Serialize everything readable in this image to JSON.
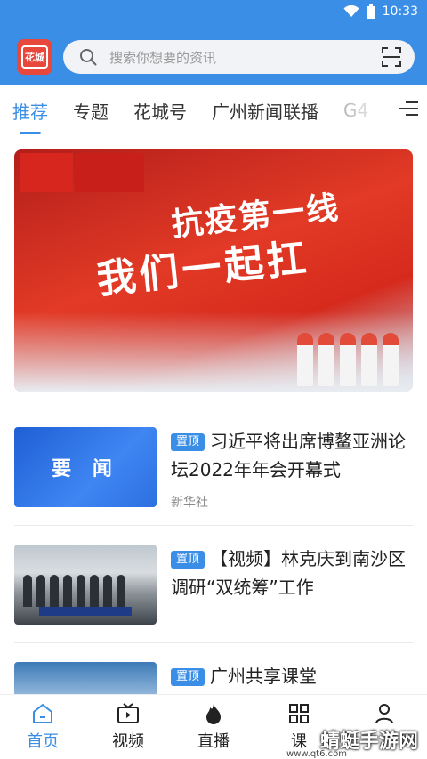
{
  "status_bar": {
    "time": "10:33"
  },
  "header": {
    "logo_text": "花城",
    "search_placeholder": "搜索你想要的资讯"
  },
  "tabs": [
    {
      "label": "推荐",
      "active": true
    },
    {
      "label": "专题"
    },
    {
      "label": "花城号"
    },
    {
      "label": "广州新闻联播"
    },
    {
      "label": "G4"
    }
  ],
  "banner": {
    "line1": "抗疫第一线",
    "line2": "我们一起扛"
  },
  "news": [
    {
      "pin": "置顶",
      "title": "习近平将出席博鳌亚洲论坛2022年年会开幕式",
      "source": "新华社",
      "thumb_text": "要 闻"
    },
    {
      "pin": "置顶",
      "title": "【视频】林克庆到南沙区调研“双统筹”工作",
      "source": ""
    },
    {
      "pin": "置顶",
      "title": "广州共享课堂",
      "source": ""
    }
  ],
  "bottom_nav": [
    {
      "label": "首页",
      "icon": "home-icon",
      "active": true
    },
    {
      "label": "视频",
      "icon": "video-icon"
    },
    {
      "label": "直播",
      "icon": "fire-icon"
    },
    {
      "label": "课",
      "icon": "grid-icon"
    },
    {
      "label": "",
      "icon": "user-icon"
    }
  ],
  "watermark": {
    "text": "蜻蜓手游网",
    "url": "www.qt6.com"
  },
  "colors": {
    "accent": "#3a8ee6",
    "logo_red": "#e8473c"
  }
}
